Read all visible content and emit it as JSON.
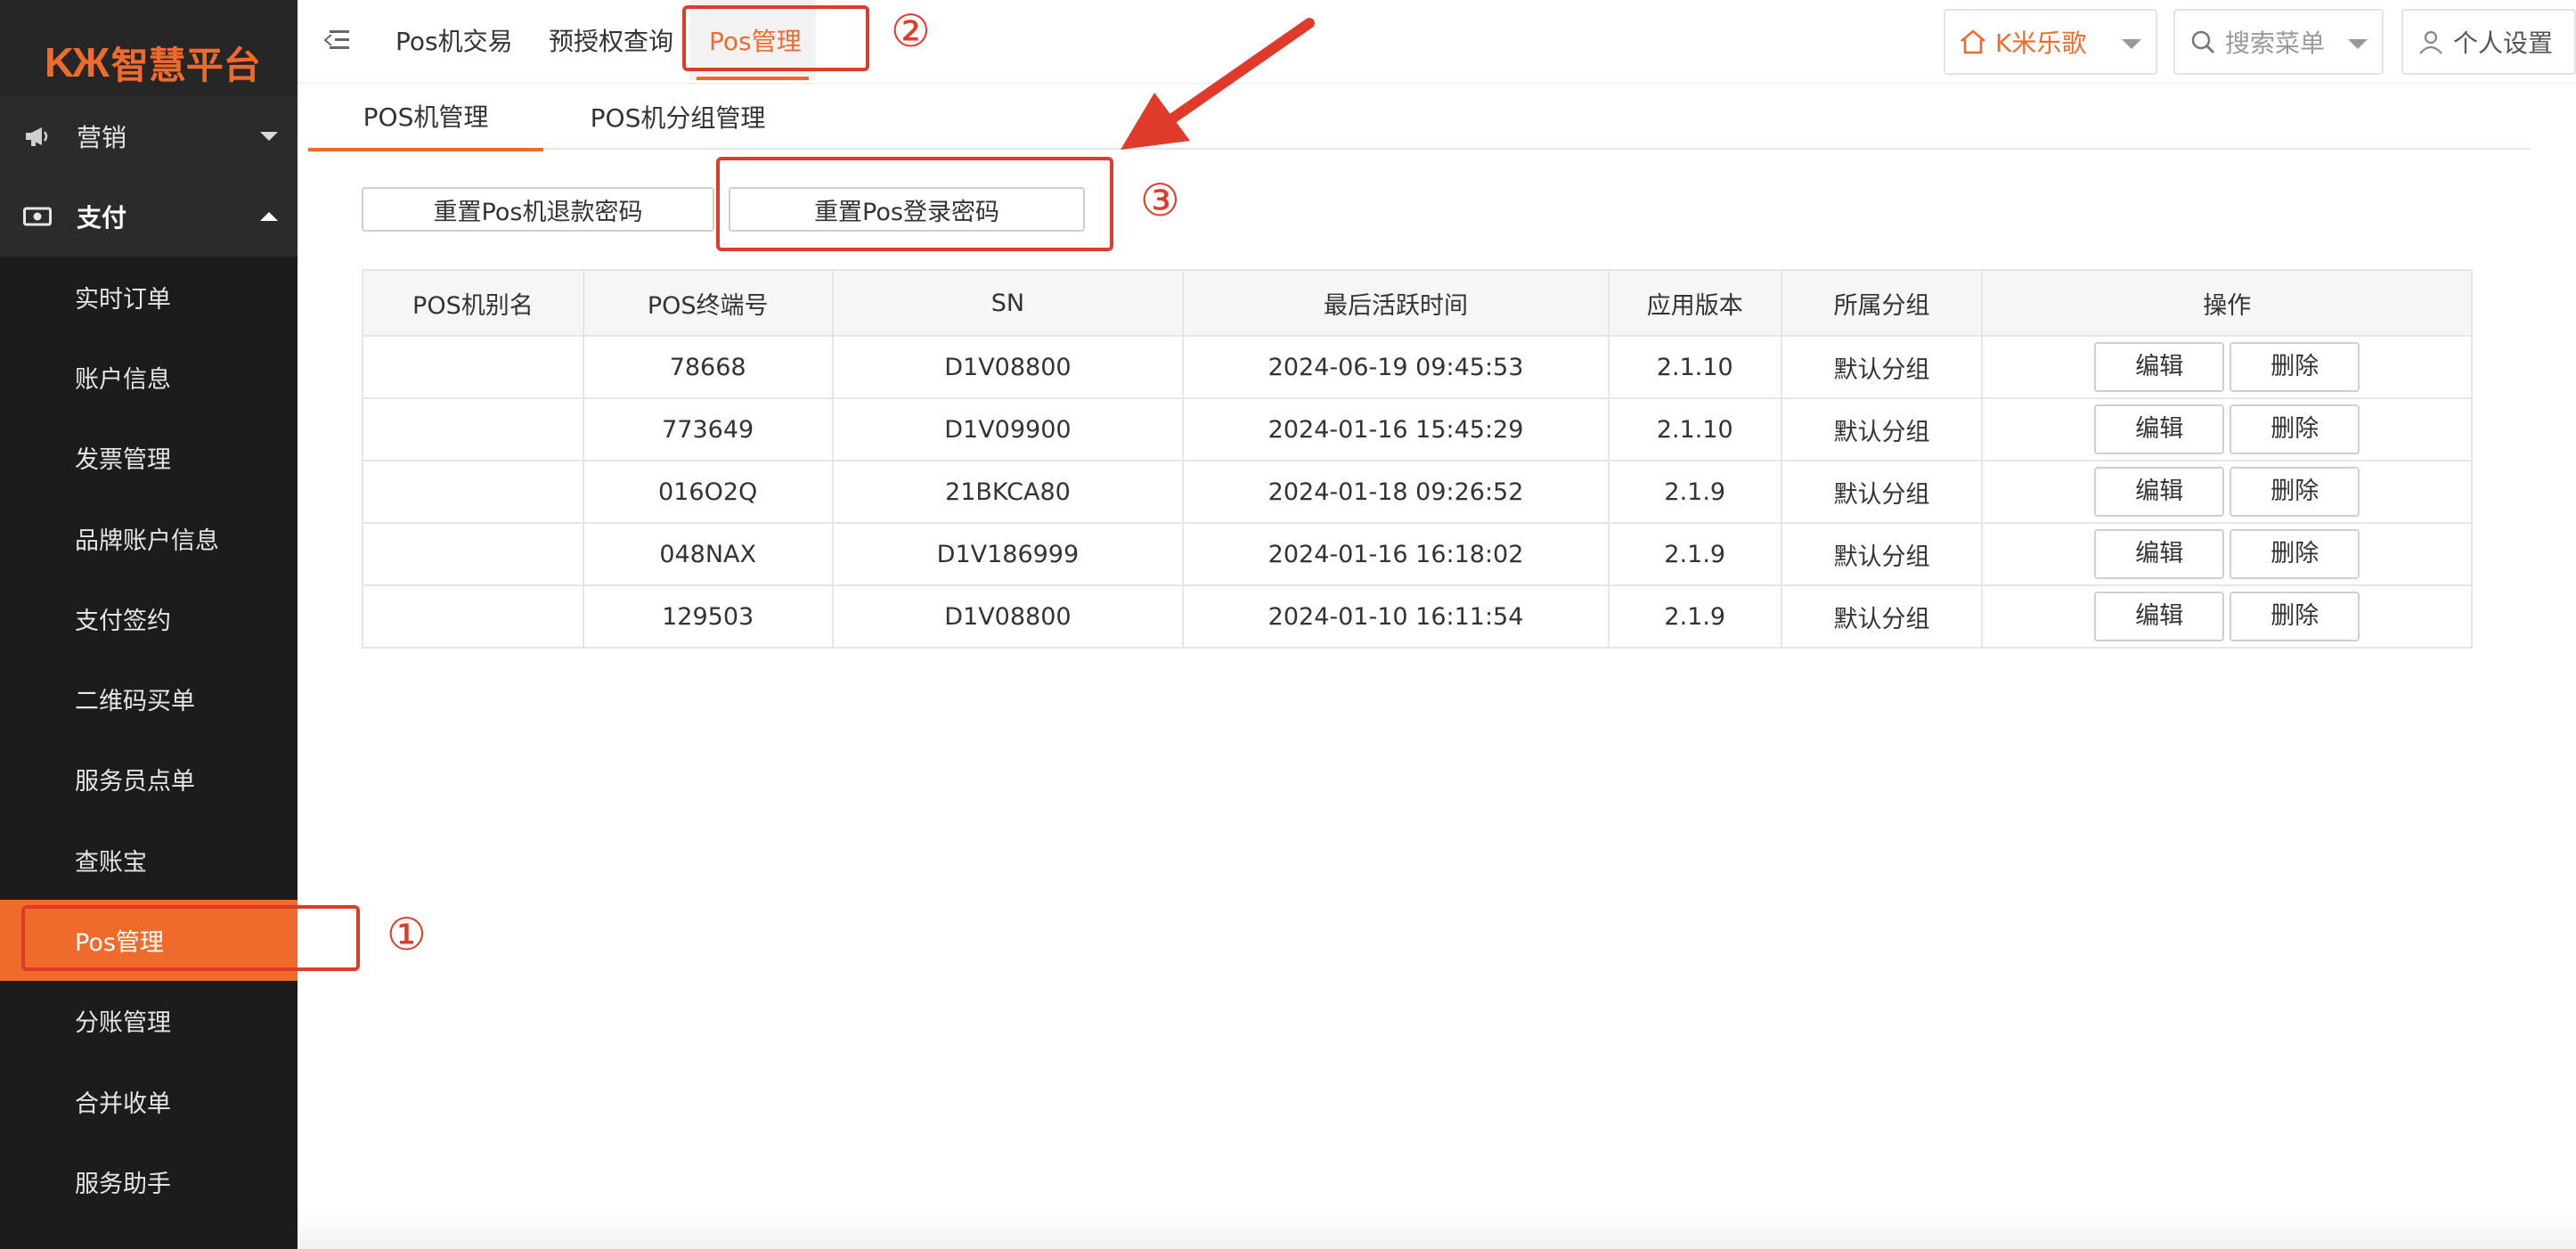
{
  "logo": {
    "mark": "KЖ",
    "text": "智慧平台"
  },
  "sidebar": {
    "groups": [
      {
        "label": "营销",
        "expanded": false,
        "icon": "megaphone-icon"
      },
      {
        "label": "支付",
        "expanded": true,
        "icon": "money-icon"
      }
    ],
    "items": [
      {
        "label": "实时订单"
      },
      {
        "label": "账户信息"
      },
      {
        "label": "发票管理"
      },
      {
        "label": "品牌账户信息"
      },
      {
        "label": "支付签约"
      },
      {
        "label": "二维码买单"
      },
      {
        "label": "服务员点单"
      },
      {
        "label": "查账宝"
      },
      {
        "label": "Pos管理",
        "active": true
      },
      {
        "label": "分账管理"
      },
      {
        "label": "合并收单"
      },
      {
        "label": "服务助手"
      }
    ]
  },
  "topbar": {
    "tabs": [
      {
        "label": "Pos机交易"
      },
      {
        "label": "预授权查询"
      },
      {
        "label": "Pos管理",
        "active": true
      }
    ],
    "store_selector": {
      "label": "K米乐歌",
      "icon": "home-icon"
    },
    "search_menu": {
      "label": "搜索菜单",
      "icon": "search-icon"
    },
    "settings": {
      "label": "个人设置",
      "icon": "user-icon"
    }
  },
  "subtabs": [
    {
      "label": "POS机管理",
      "active": true
    },
    {
      "label": "POS机分组管理"
    }
  ],
  "actions": {
    "reset_refund_pwd": "重置Pos机退款密码",
    "reset_login_pwd": "重置Pos登录密码"
  },
  "table": {
    "headers": [
      "POS机别名",
      "POS终端号",
      "SN",
      "最后活跃时间",
      "应用版本",
      "所属分组",
      "操作"
    ],
    "rows": [
      {
        "alias": "",
        "terminal": "78668",
        "sn": "D1V08800",
        "last_active": "2024-06-19 09:45:53",
        "version": "2.1.10",
        "group": "默认分组"
      },
      {
        "alias": "",
        "terminal": "773649",
        "sn": "D1V09900",
        "last_active": "2024-01-16 15:45:29",
        "version": "2.1.10",
        "group": "默认分组"
      },
      {
        "alias": "",
        "terminal": "016O2Q",
        "sn": "21BKCA80",
        "last_active": "2024-01-18 09:26:52",
        "version": "2.1.9",
        "group": "默认分组"
      },
      {
        "alias": "",
        "terminal": "048NAX",
        "sn": "D1V186999",
        "last_active": "2024-01-16 16:18:02",
        "version": "2.1.9",
        "group": "默认分组"
      },
      {
        "alias": "",
        "terminal": "129503",
        "sn": "D1V08800",
        "last_active": "2024-01-10 16:11:54",
        "version": "2.1.9",
        "group": "默认分组"
      }
    ],
    "edit_label": "编辑",
    "delete_label": "删除"
  },
  "annotations": {
    "step1": "①",
    "step2": "②",
    "step3": "③",
    "color": "#e03a2a"
  },
  "colors": {
    "accent": "#ef6b2c",
    "sidebar_bg": "#1c1c1c"
  }
}
